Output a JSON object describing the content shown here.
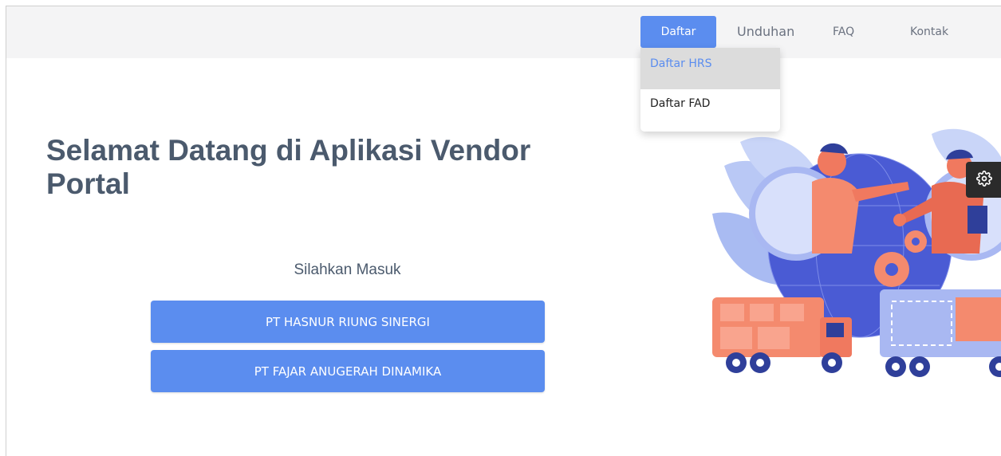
{
  "nav": {
    "items": [
      {
        "label": "Daftar",
        "active": true
      },
      {
        "label": "Unduhan"
      },
      {
        "label": "FAQ"
      },
      {
        "label": "Kontak"
      }
    ],
    "dropdown": [
      {
        "label": "Daftar HRS",
        "highlighted": true
      },
      {
        "label": "Daftar FAD"
      }
    ]
  },
  "hero": {
    "title": "Selamat Datang di Aplikasi Vendor Portal"
  },
  "login": {
    "prompt": "Silahkan Masuk",
    "companies": [
      {
        "label": "PT HASNUR RIUNG SINERGI"
      },
      {
        "label": "PT FAJAR ANUGERAH DINAMIKA"
      }
    ]
  },
  "icons": {
    "settings": "gear-icon",
    "illustration": "handshake-logistics-illustration"
  },
  "colors": {
    "accent": "#5b8def",
    "title": "#4b5a6d",
    "navbar_bg": "#f4f4f5",
    "dropdown_highlight": "#dcdcdc"
  }
}
